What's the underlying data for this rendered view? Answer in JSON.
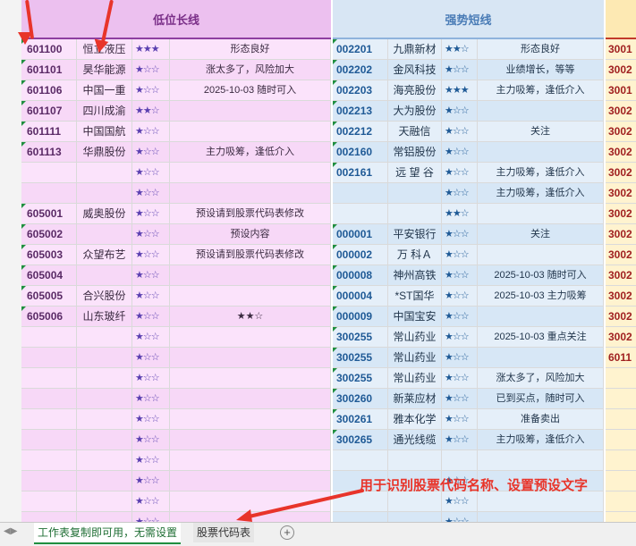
{
  "headers": {
    "left": "低位长线",
    "middle": "强势短线"
  },
  "left_rows": [
    {
      "code": "601100",
      "name": "恒立液压",
      "stars": "★★★",
      "note": "形态良好"
    },
    {
      "code": "601101",
      "name": "昊华能源",
      "stars": "★☆☆",
      "note": "涨太多了，风险加大"
    },
    {
      "code": "601106",
      "name": "中国一重",
      "stars": "★☆☆",
      "note": "2025-10-03 随时可入"
    },
    {
      "code": "601107",
      "name": "四川成渝",
      "stars": "★★☆",
      "note": ""
    },
    {
      "code": "601111",
      "name": "中国国航",
      "stars": "★☆☆",
      "note": ""
    },
    {
      "code": "601113",
      "name": "华鼎股份",
      "stars": "★☆☆",
      "note": "主力吸筹，逢低介入"
    },
    {
      "code": "",
      "name": "",
      "stars": "★☆☆",
      "note": ""
    },
    {
      "code": "",
      "name": "",
      "stars": "★☆☆",
      "note": ""
    },
    {
      "code": "605001",
      "name": "威奥股份",
      "stars": "★☆☆",
      "note": "预设请到股票代码表修改"
    },
    {
      "code": "605002",
      "name": "",
      "stars": "★☆☆",
      "note": "预设内容"
    },
    {
      "code": "605003",
      "name": "众望布艺",
      "stars": "★☆☆",
      "note": "预设请到股票代码表修改"
    },
    {
      "code": "605004",
      "name": "",
      "stars": "★☆☆",
      "note": ""
    },
    {
      "code": "605005",
      "name": "合兴股份",
      "stars": "★☆☆",
      "note": ""
    },
    {
      "code": "605006",
      "name": "山东玻纤",
      "stars": "★☆☆",
      "note": "★★☆"
    },
    {
      "code": "",
      "name": "",
      "stars": "★☆☆",
      "note": ""
    },
    {
      "code": "",
      "name": "",
      "stars": "★☆☆",
      "note": ""
    },
    {
      "code": "",
      "name": "",
      "stars": "★☆☆",
      "note": ""
    },
    {
      "code": "",
      "name": "",
      "stars": "★☆☆",
      "note": ""
    },
    {
      "code": "",
      "name": "",
      "stars": "★☆☆",
      "note": ""
    },
    {
      "code": "",
      "name": "",
      "stars": "★☆☆",
      "note": ""
    },
    {
      "code": "",
      "name": "",
      "stars": "★☆☆",
      "note": ""
    },
    {
      "code": "",
      "name": "",
      "stars": "★☆☆",
      "note": ""
    },
    {
      "code": "",
      "name": "",
      "stars": "★☆☆",
      "note": ""
    },
    {
      "code": "",
      "name": "",
      "stars": "★☆☆",
      "note": ""
    }
  ],
  "mid_rows": [
    {
      "code": "002201",
      "name": "九鼎新材",
      "stars": "★★☆",
      "note": "形态良好"
    },
    {
      "code": "002202",
      "name": "金风科技",
      "stars": "★☆☆",
      "note": "业绩增长，等等"
    },
    {
      "code": "002203",
      "name": "海亮股份",
      "stars": "★★★",
      "note": "主力吸筹，逢低介入"
    },
    {
      "code": "002213",
      "name": "大为股份",
      "stars": "★☆☆",
      "note": ""
    },
    {
      "code": "002212",
      "name": "天融信",
      "stars": "★☆☆",
      "note": "关注"
    },
    {
      "code": "002160",
      "name": "常铝股份",
      "stars": "★☆☆",
      "note": ""
    },
    {
      "code": "002161",
      "name": "远 望 谷",
      "stars": "★☆☆",
      "note": "主力吸筹，逢低介入"
    },
    {
      "code": "",
      "name": "",
      "stars": "★☆☆",
      "note": "主力吸筹，逢低介入"
    },
    {
      "code": "",
      "name": "",
      "stars": "★★☆",
      "note": ""
    },
    {
      "code": "000001",
      "name": "平安银行",
      "stars": "★☆☆",
      "note": "关注"
    },
    {
      "code": "000002",
      "name": "万 科Ａ",
      "stars": "★☆☆",
      "note": ""
    },
    {
      "code": "000008",
      "name": "神州高铁",
      "stars": "★☆☆",
      "note": "2025-10-03 随时可入"
    },
    {
      "code": "000004",
      "name": "*ST国华",
      "stars": "★☆☆",
      "note": "2025-10-03 主力吸筹"
    },
    {
      "code": "000009",
      "name": "中国宝安",
      "stars": "★☆☆",
      "note": ""
    },
    {
      "code": "300255",
      "name": "常山药业",
      "stars": "★☆☆",
      "note": "2025-10-03 重点关注"
    },
    {
      "code": "300255",
      "name": "常山药业",
      "stars": "★☆☆",
      "note": ""
    },
    {
      "code": "300255",
      "name": "常山药业",
      "stars": "★☆☆",
      "note": "涨太多了，风险加大"
    },
    {
      "code": "300260",
      "name": "新莱应材",
      "stars": "★☆☆",
      "note": "已到买点，随时可入"
    },
    {
      "code": "300261",
      "name": "雅本化学",
      "stars": "★☆☆",
      "note": "准备卖出"
    },
    {
      "code": "300265",
      "name": "通光线缆",
      "stars": "★☆☆",
      "note": "主力吸筹，逢低介入"
    },
    {
      "code": "",
      "name": "",
      "stars": "",
      "note": ""
    },
    {
      "code": "",
      "name": "",
      "stars": "★☆☆",
      "note": ""
    },
    {
      "code": "",
      "name": "",
      "stars": "★☆☆",
      "note": ""
    },
    {
      "code": "",
      "name": "",
      "stars": "★☆☆",
      "note": ""
    }
  ],
  "right_codes": [
    "3001",
    "3002",
    "3001",
    "3002",
    "3002",
    "3002",
    "3002",
    "3002",
    "3002",
    "3002",
    "3002",
    "3002",
    "3002",
    "3002",
    "3002",
    "6011",
    "",
    "",
    "",
    "",
    "",
    "",
    "",
    ""
  ],
  "annotation": "用于识别股票代码名称、设置预设文字",
  "tabs": {
    "tab1": "工作表复制即可用，无需设置",
    "tab2": "股票代码表",
    "add": "+"
  },
  "colors": {
    "left_header": "#ecc0ef",
    "mid_header": "#d8e6f4",
    "right_header": "#fde9b3",
    "arrow": "#e8342a",
    "marker": "#1f8f3f"
  }
}
